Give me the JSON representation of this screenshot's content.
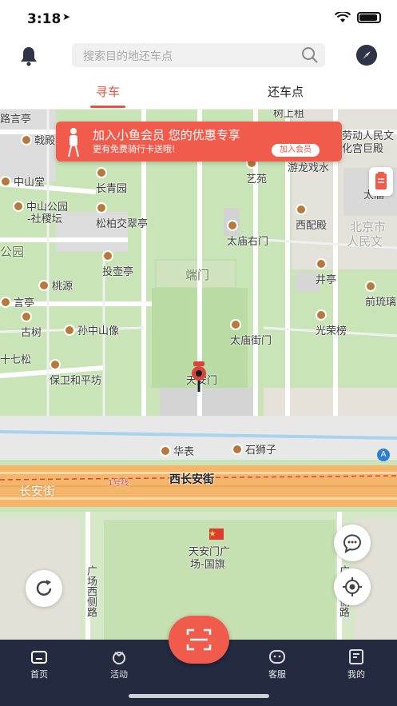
{
  "status": {
    "time": "3:18",
    "location_arrow": "➤"
  },
  "header": {
    "search_placeholder": "搜索目的地还车点"
  },
  "tabs": {
    "find": "寻车",
    "return": "还车点"
  },
  "banner": {
    "title": "加入小鱼会员 您的优惠专享",
    "subtitle": "更有免费骑行卡送哦!",
    "button": "加入会员"
  },
  "map": {
    "labels": {
      "l_luyanting": "路言亭",
      "l_zhandeng": "戟殿",
      "l_zhongshantang": "中山堂",
      "l_changqingyuan": "长青园",
      "l_zhongshangongyuan": "中山公园",
      "l_sheji": "-社稷坛",
      "l_songbai": "松柏交翠亭",
      "l_gongyuan": "公园",
      "l_touhu": "投壶亭",
      "l_taoyuan": "桃源",
      "l_yanting": "言亭",
      "l_gushu": "古树",
      "l_sunzhongshan": "孙中山像",
      "l_qisong": "十七松",
      "l_baowei": "保卫和平坊",
      "l_duanmen": "端门",
      "l_tiananmen": "天安门",
      "l_shuyuan": "树上租",
      "l_laodong": "劳动人民文",
      "l_huagong": "化宫巨殿",
      "l_yiyuan": "艺苑",
      "l_youlong": "游龙戏水",
      "l_tai": "太庙",
      "l_taimiao_right": "太庙右门",
      "l_xipei": "西配殿",
      "l_beijingshi": "北京市",
      "l_renmin": "人民文",
      "l_jingting": "井亭",
      "l_qianliu": "前琉璃",
      "l_guangrong": "光荣榜",
      "l_taimiaojie": "太庙街门",
      "l_huabiao": "华表",
      "l_shishizi": "石狮子",
      "l_changanjie": "长安街",
      "l_line1": "1号线",
      "l_xichanganjie": "西长安街",
      "l_guangchang": "天安门广",
      "l_guoqi": "场-国旗",
      "l_guangxi": "广场西侧路",
      "l_guangdong": "广场东侧路",
      "l_A": "A"
    }
  },
  "nav": {
    "home": "首页",
    "activity": "活动",
    "service": "客服",
    "mine": "我的"
  },
  "colors": {
    "accent": "#f15b4c",
    "nav_bg": "#242a40"
  }
}
